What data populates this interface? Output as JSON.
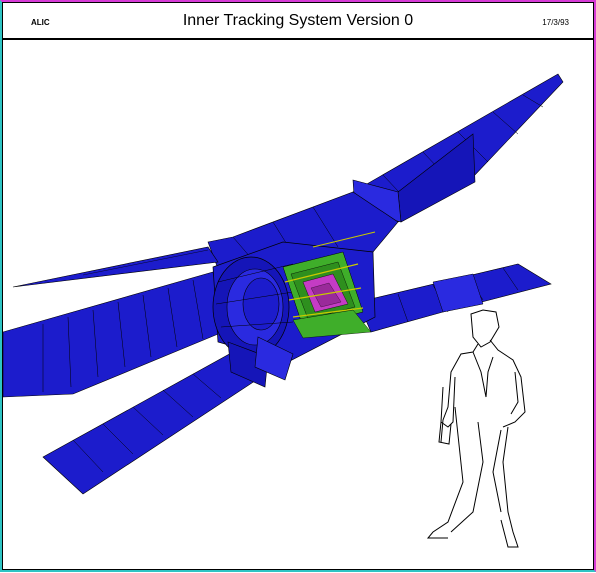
{
  "header": {
    "left_label": "ALIC",
    "title": "Inner Tracking System Version 0",
    "date": "17/3/93"
  },
  "colors": {
    "frame_outer_top_right": "#d63bd6",
    "frame_outer_bottom_left": "#2ec4c4",
    "detector_blue": "#1c1ccc",
    "detector_blue_light": "#3a3af0",
    "detector_green": "#3fae2a",
    "detector_magenta": "#c43cc4",
    "detector_yellow": "#c8c800",
    "figure_outline": "#000000"
  },
  "scene": {
    "subject": "its-detector-3d-view",
    "scale_reference": "human-figure-outline"
  }
}
